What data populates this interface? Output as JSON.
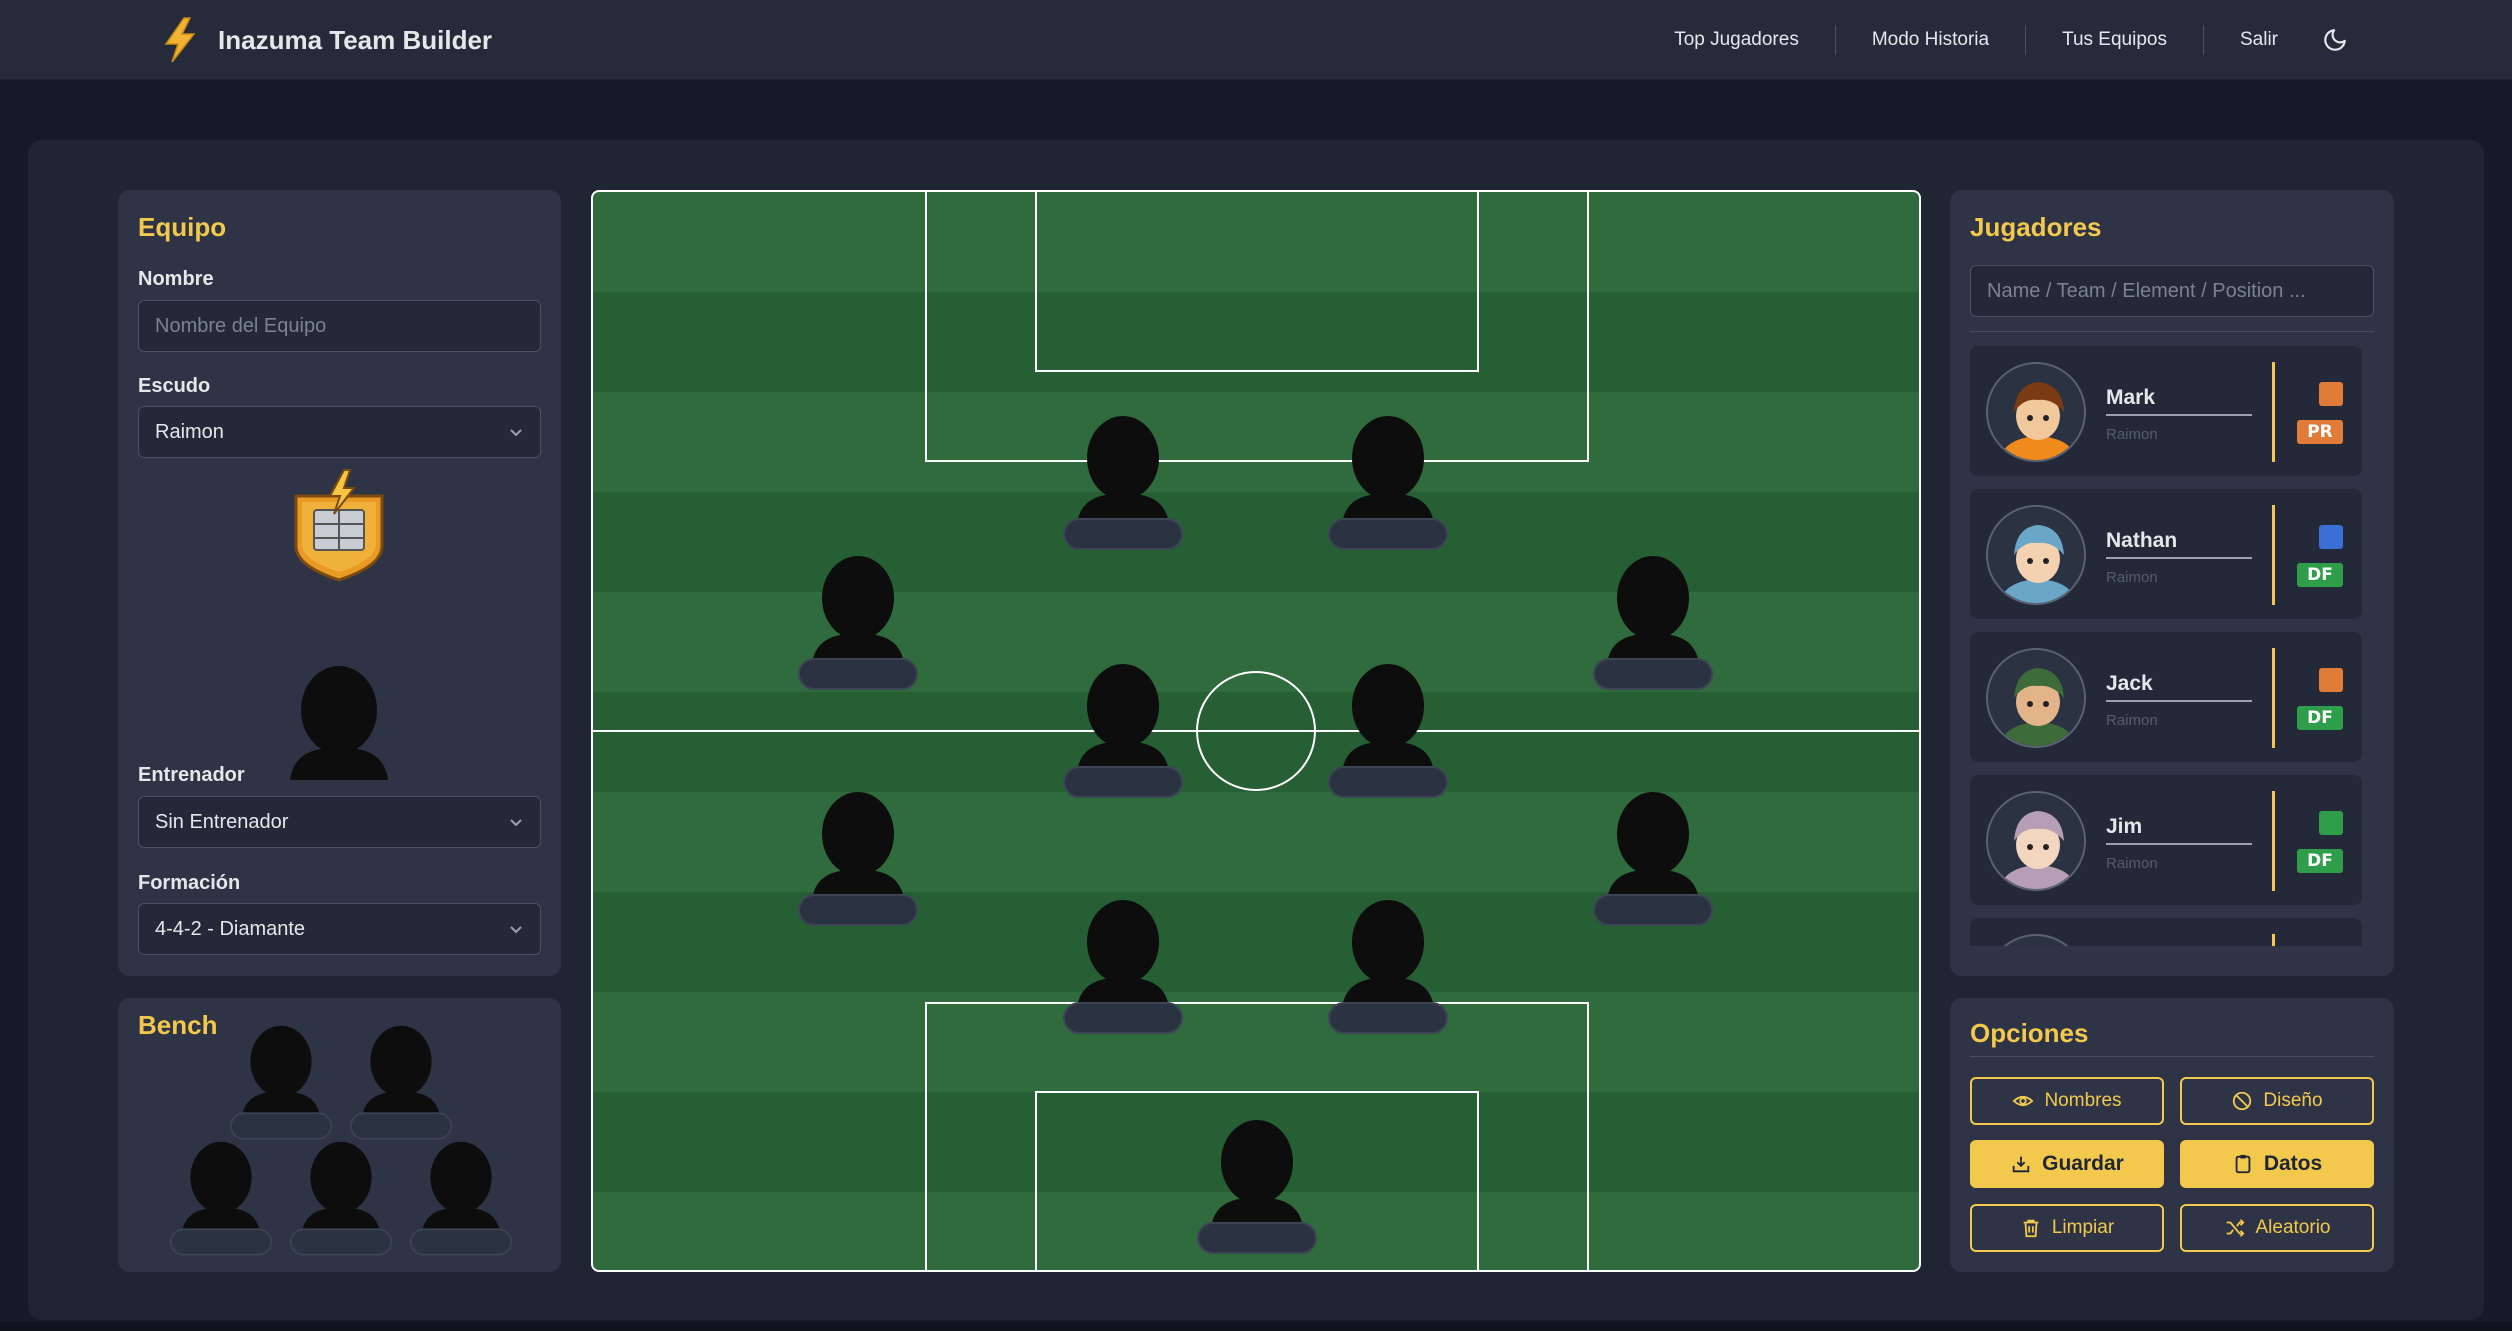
{
  "app": {
    "title": "Inazuma Team Builder"
  },
  "nav": {
    "links": [
      "Top Jugadores",
      "Modo Historia",
      "Tus Equipos",
      "Salir"
    ],
    "theme_icon": "moon-icon"
  },
  "equipo": {
    "title": "Equipo",
    "nombre_label": "Nombre",
    "nombre_placeholder": "Nombre del Equipo",
    "nombre_value": "",
    "escudo_label": "Escudo",
    "escudo_value": "Raimon",
    "entrenador_label": "Entrenador",
    "entrenador_value": "Sin Entrenador",
    "formacion_label": "Formación",
    "formacion_value": "4-4-2 - Diamante"
  },
  "bench": {
    "title": "Bench",
    "slots": 5
  },
  "field": {
    "empty_slots": 11
  },
  "jugadores": {
    "title": "Jugadores",
    "search_placeholder": "Name / Team / Element / Position ...",
    "players": [
      {
        "name": "Mark",
        "team": "Raimon",
        "position": "PR",
        "element": "fire",
        "element_color": "#e07b39",
        "position_color": "#e07b39"
      },
      {
        "name": "Nathan",
        "team": "Raimon",
        "position": "DF",
        "element": "wind",
        "element_color": "#3b6fd6",
        "position_color": "#2e9e4a"
      },
      {
        "name": "Jack",
        "team": "Raimon",
        "position": "DF",
        "element": "fire",
        "element_color": "#e07b39",
        "position_color": "#2e9e4a"
      },
      {
        "name": "Jim",
        "team": "Raimon",
        "position": "DF",
        "element": "wood",
        "element_color": "#2e9e4a",
        "position_color": "#2e9e4a"
      }
    ]
  },
  "opciones": {
    "title": "Opciones",
    "buttons": {
      "nombres": "Nombres",
      "diseno": "Diseño",
      "guardar": "Guardar",
      "datos": "Datos",
      "limpiar": "Limpiar",
      "aleatorio": "Aleatorio"
    }
  },
  "colors": {
    "accent": "#f2c94c",
    "panel": "#2e3445",
    "pitch_light": "#2f6b3c",
    "pitch_dark": "#275f34"
  }
}
